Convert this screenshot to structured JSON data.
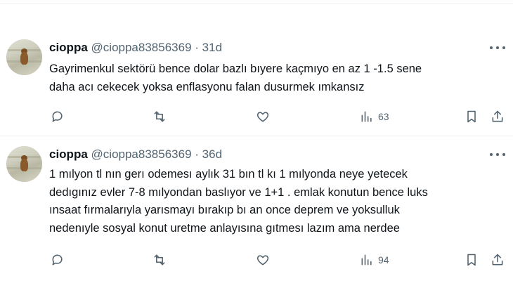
{
  "tweets": [
    {
      "name": "cioppa",
      "handle": "@cioppa83856369",
      "separator": "·",
      "time": "31d",
      "lines": [
        "Gayrimenkul sektörü bence dolar bazlı bıyere kaçmıyo en az 1 -1.5 sene",
        "daha acı cekecek yoksa enflasyonu falan dusurmek ımkansız"
      ],
      "views": "63"
    },
    {
      "name": "cioppa",
      "handle": "@cioppa83856369",
      "separator": "·",
      "time": "36d",
      "lines": [
        "1 mılyon tl nın gerı odemesı aylık 31 bın tl kı 1 mılyonda neye yetecek",
        "dedıgınız evler 7-8 mılyondan baslıyor ve 1+1 . emlak konutun bence luks",
        "ınsaat fırmalarıyla yarısmayı bırakıp bı an once deprem ve yoksulluk",
        "nedenıyle sosyal konut uretme anlayısına gıtmesı lazım ama  nerdee"
      ],
      "views": "94"
    }
  ],
  "icons": {
    "reply": "reply-icon",
    "retweet": "retweet-icon",
    "like": "heart-icon",
    "views": "views-icon",
    "bookmark": "bookmark-icon",
    "share": "share-icon",
    "more": "more-icon"
  },
  "colors": {
    "text": "#0f1419",
    "secondary": "#536471",
    "divider": "#eff3f4"
  }
}
